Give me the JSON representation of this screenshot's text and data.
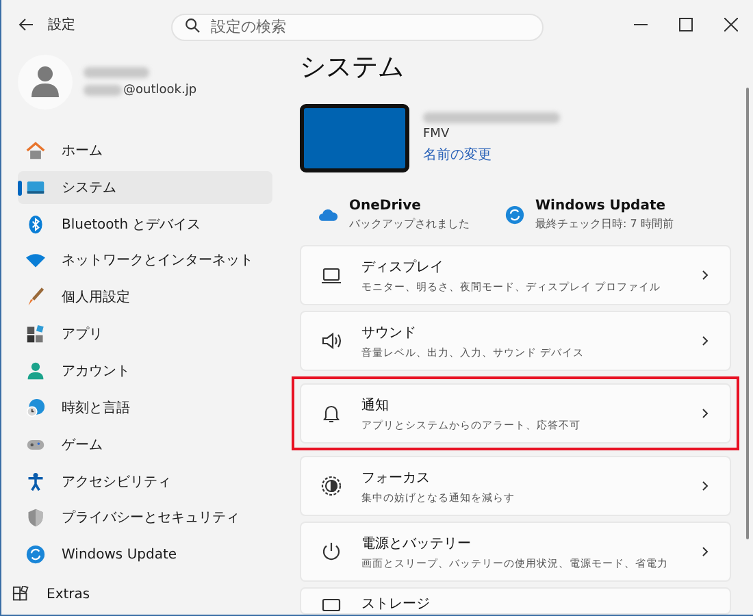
{
  "window": {
    "title": "設定"
  },
  "search": {
    "placeholder": "設定の検索"
  },
  "account": {
    "email": "@outlook.jp"
  },
  "sidebar": {
    "items": [
      {
        "label": "ホーム",
        "selected": false
      },
      {
        "label": "システム",
        "selected": true
      },
      {
        "label": "Bluetooth とデバイス",
        "selected": false
      },
      {
        "label": "ネットワークとインターネット",
        "selected": false
      },
      {
        "label": "個人用設定",
        "selected": false
      },
      {
        "label": "アプリ",
        "selected": false
      },
      {
        "label": "アカウント",
        "selected": false
      },
      {
        "label": "時刻と言語",
        "selected": false
      },
      {
        "label": "ゲーム",
        "selected": false
      },
      {
        "label": "アクセシビリティ",
        "selected": false
      },
      {
        "label": "プライバシーとセキュリティ",
        "selected": false
      },
      {
        "label": "Windows Update",
        "selected": false
      }
    ],
    "extras": "Extras"
  },
  "page": {
    "title": "システム",
    "device": {
      "model": "FMV",
      "rename_link": "名前の変更"
    },
    "status": [
      {
        "title": "OneDrive",
        "subtitle": "バックアップされました"
      },
      {
        "title": "Windows Update",
        "subtitle": "最終チェック日時: 7 時間前"
      }
    ],
    "settings": [
      {
        "title": "ディスプレイ",
        "subtitle": "モニター、明るさ、夜間モード、ディスプレイ プロファイル",
        "highlighted": false
      },
      {
        "title": "サウンド",
        "subtitle": "音量レベル、出力、入力、サウンド デバイス",
        "highlighted": false
      },
      {
        "title": "通知",
        "subtitle": "アプリとシステムからのアラート、応答不可",
        "highlighted": true
      },
      {
        "title": "フォーカス",
        "subtitle": "集中の妨げとなる通知を減らす",
        "highlighted": false
      },
      {
        "title": "電源とバッテリー",
        "subtitle": "画面とスリープ、バッテリーの使用状況、電源モード、省電力",
        "highlighted": false
      },
      {
        "title": "ストレージ",
        "highlighted": false
      }
    ]
  }
}
